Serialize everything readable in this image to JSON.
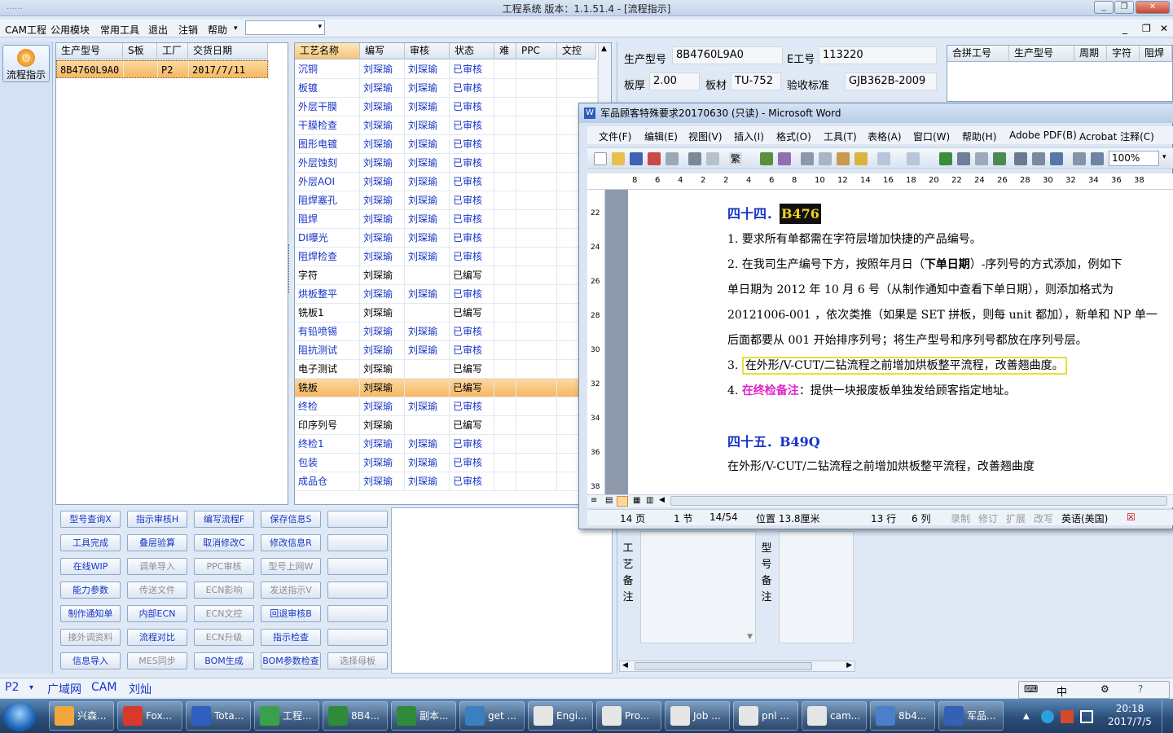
{
  "window": {
    "title": "工程系统  版本：1.1.51.4 - [流程指示]",
    "blur_title": "……"
  },
  "menu": {
    "items": [
      "CAM工程",
      "公用模块",
      "常用工具",
      "退出",
      "注销",
      "帮助"
    ],
    "mdi_controls": [
      "_",
      "❐",
      "✕"
    ]
  },
  "sidebar": {
    "flow_button": "流程指示"
  },
  "orders": {
    "headers": [
      "生产型号",
      "S板",
      "工厂",
      "交货日期"
    ],
    "rows": [
      {
        "model": "8B4760L9A0",
        "s": "",
        "factory": "P2",
        "date": "2017/7/11"
      }
    ]
  },
  "process": {
    "headers": [
      "工艺名称",
      "编写",
      "审核",
      "状态",
      "难",
      "PPC",
      "文控"
    ],
    "rows": [
      {
        "name": "沉铜",
        "writer": "刘琛瑜",
        "reviewer": "刘琛瑜",
        "status": "已审核"
      },
      {
        "name": "板镀",
        "writer": "刘琛瑜",
        "reviewer": "刘琛瑜",
        "status": "已审核"
      },
      {
        "name": "外层干膜",
        "writer": "刘琛瑜",
        "reviewer": "刘琛瑜",
        "status": "已审核"
      },
      {
        "name": "干膜检查",
        "writer": "刘琛瑜",
        "reviewer": "刘琛瑜",
        "status": "已审核"
      },
      {
        "name": "图形电镀",
        "writer": "刘琛瑜",
        "reviewer": "刘琛瑜",
        "status": "已审核"
      },
      {
        "name": "外层蚀刻",
        "writer": "刘琛瑜",
        "reviewer": "刘琛瑜",
        "status": "已审核"
      },
      {
        "name": "外层AOI",
        "writer": "刘琛瑜",
        "reviewer": "刘琛瑜",
        "status": "已审核"
      },
      {
        "name": "阻焊塞孔",
        "writer": "刘琛瑜",
        "reviewer": "刘琛瑜",
        "status": "已审核"
      },
      {
        "name": "阻焊",
        "writer": "刘琛瑜",
        "reviewer": "刘琛瑜",
        "status": "已审核"
      },
      {
        "name": "DI曝光",
        "writer": "刘琛瑜",
        "reviewer": "刘琛瑜",
        "status": "已审核"
      },
      {
        "name": "阻焊检查",
        "writer": "刘琛瑜",
        "reviewer": "刘琛瑜",
        "status": "已审核"
      },
      {
        "name": "字符",
        "writer": "刘琛瑜",
        "reviewer": "",
        "status": "已编写"
      },
      {
        "name": "烘板整平",
        "writer": "刘琛瑜",
        "reviewer": "刘琛瑜",
        "status": "已审核"
      },
      {
        "name": "铣板1",
        "writer": "刘琛瑜",
        "reviewer": "",
        "status": "已编写"
      },
      {
        "name": "有铅喷锡",
        "writer": "刘琛瑜",
        "reviewer": "刘琛瑜",
        "status": "已审核"
      },
      {
        "name": "阻抗测试",
        "writer": "刘琛瑜",
        "reviewer": "刘琛瑜",
        "status": "已审核"
      },
      {
        "name": "电子测试",
        "writer": "刘琛瑜",
        "reviewer": "",
        "status": "已编写"
      },
      {
        "name": "铣板",
        "writer": "刘琛瑜",
        "reviewer": "",
        "status": "已编写"
      },
      {
        "name": "终检",
        "writer": "刘琛瑜",
        "reviewer": "刘琛瑜",
        "status": "已审核"
      },
      {
        "name": "印序列号",
        "writer": "刘琛瑜",
        "reviewer": "",
        "status": "已编写"
      },
      {
        "name": "终检1",
        "writer": "刘琛瑜",
        "reviewer": "刘琛瑜",
        "status": "已审核"
      },
      {
        "name": "包装",
        "writer": "刘琛瑜",
        "reviewer": "刘琛瑜",
        "status": "已审核"
      },
      {
        "name": "成品仓",
        "writer": "刘琛瑜",
        "reviewer": "刘琛瑜",
        "status": "已审核"
      }
    ],
    "selected_index": 17
  },
  "buttons": [
    [
      "型号查询X",
      "指示审核H",
      "编写流程F",
      "保存信息S",
      ""
    ],
    [
      "工具完成",
      "叠层验算",
      "取消修改C",
      "修改信息R",
      ""
    ],
    [
      "在线WIP",
      "调单导入",
      "PPC审核",
      "型号上网W",
      ""
    ],
    [
      "能力参数",
      "传送文件",
      "ECN影响",
      "发送指示V",
      ""
    ],
    [
      "制作通知单",
      "内部ECN",
      "ECN文控",
      "回退审核B",
      ""
    ],
    [
      "接外调资料",
      "流程对比",
      "ECN升级",
      "指示检查",
      ""
    ],
    [
      "信息导入",
      "MES同步",
      "BOM生成",
      "BOM参数检查",
      "选择母板"
    ]
  ],
  "disabled_buttons": [
    "调单导入",
    "PPC审核",
    "型号上网W",
    "传送文件",
    "ECN影响",
    "发送指示V",
    "ECN文控",
    "接外调资料",
    "ECN升级",
    "MES同步",
    "选择母板"
  ],
  "info": {
    "model_label": "生产型号",
    "model": "8B4760L9A0",
    "eno_label": "E工号",
    "eno": "113220",
    "thick_label": "板厚",
    "thick": "2.00",
    "mat_label": "板材",
    "mat": "TU-752",
    "std_label": "验收标准",
    "std": "GJB362B-2009"
  },
  "merge": {
    "headers": [
      "合拼工号",
      "生产型号",
      "周期",
      "字符",
      "阻焊"
    ]
  },
  "word": {
    "title": "军品顾客特殊要求20170630 (只读) - Microsoft Word",
    "menu": [
      "文件(F)",
      "编辑(E)",
      "视图(V)",
      "插入(I)",
      "格式(O)",
      "工具(T)",
      "表格(A)",
      "窗口(W)",
      "帮助(H)",
      "Adobe PDF(B)",
      "Acrobat 注释(C)"
    ],
    "zoom": "100%",
    "ruler": [
      "8",
      "6",
      "4",
      "2",
      "2",
      "4",
      "6",
      "8",
      "10",
      "12",
      "14",
      "16",
      "18",
      "20",
      "22",
      "24",
      "26",
      "28",
      "30",
      "32",
      "34",
      "36",
      "38"
    ],
    "vruler": [
      "22",
      "24",
      "26",
      "28",
      "30",
      "32",
      "34",
      "36",
      "38"
    ],
    "doc": {
      "h44_prefix": "四十四．",
      "h44_code": "B476",
      "l1": "1.  要求所有单都需在字符层增加快捷的产品编号。",
      "l2a": "2.  在我司生产编号下方，按照年月日（",
      "l2b": "下单日期",
      "l2c": "）-序列号的方式添加，例如下",
      "l3": "单日期为  2012  年  10  月  6  号（从制作通知中查看下单日期），则添加格式为",
      "l4": "20121006-001 ，依次类推（如果是 SET 拼板，则每 unit 都加），新单和 NP 单一",
      "l5": "后面都要从 001 开始排序列号；将生产型号和序列号都放在序列号层。",
      "l6_num": "3. ",
      "l6": "在外形/V-CUT/二钻流程之前增加烘板整平流程，改善翘曲度。",
      "l7_num": "4. ",
      "l7a": "在终检备注",
      "l7b": "：提供一块报废板单独发给顾客指定地址。",
      "h45": "四十五．B49Q",
      "l8": "在外形/V-CUT/二钻流程之前增加烘板整平流程，改善翘曲度"
    },
    "status": {
      "page": "14 页",
      "section": "1 节",
      "pages": "14/54",
      "pos": "位置 13.8厘米",
      "line": "13 行",
      "col": "6 列",
      "rec": "录制",
      "trk": "修订",
      "ext": "扩展",
      "ovr": "改写",
      "lang": "英语(美国)"
    }
  },
  "notes": {
    "left": "工艺备注",
    "right": "型号备注"
  },
  "statusbar": {
    "factory": "P2",
    "net": "广域网",
    "cam": "CAM",
    "user": "刘灿"
  },
  "ime": {
    "lang": "中"
  },
  "taskbar": {
    "items": [
      "兴森...",
      "Fox...",
      "Tota...",
      "工程...",
      "8B4...",
      "副本...",
      "get ...",
      "Engi...",
      "Pro...",
      "Job ...",
      "pnl ...",
      "cam...",
      "8b4...",
      "军品..."
    ],
    "icon_colors": [
      "#f1a73a",
      "#d8392b",
      "#2f5fbf",
      "#3aa14a",
      "#2f8a3a",
      "#2f8a3a",
      "#3b7fbf",
      "#e6e6e6",
      "#e6e6e6",
      "#e6e6e6",
      "#e6e6e6",
      "#e6e6e6",
      "#4a7fc9",
      "#3460b5"
    ],
    "time": "20:18",
    "date": "2017/7/5"
  }
}
